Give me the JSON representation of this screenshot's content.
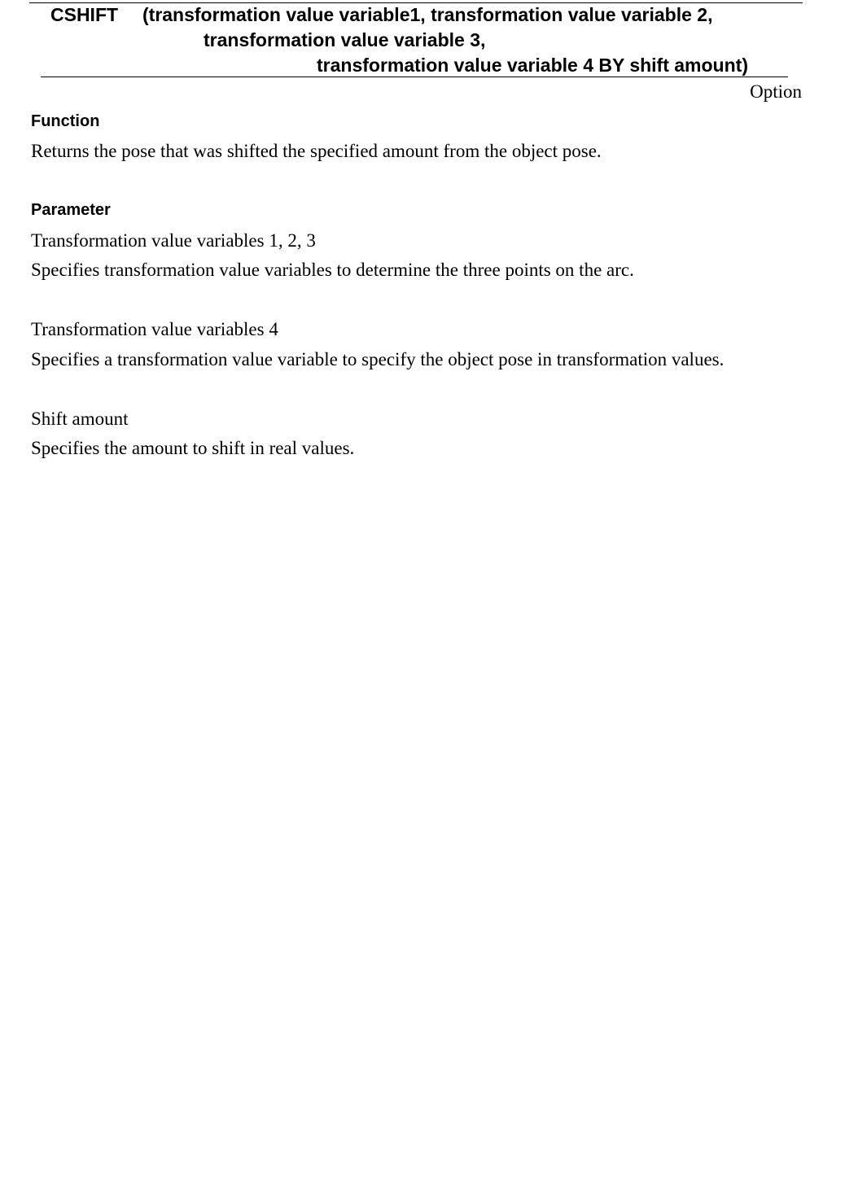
{
  "signature": {
    "name": "CSHIFT",
    "line1": "(transformation value variable1, transformation value variable 2,",
    "line2": "transformation value variable 3,",
    "line3": "transformation value variable 4 BY shift amount)"
  },
  "option_label": "Option",
  "function": {
    "heading": "Function",
    "text": "Returns the pose that was shifted the specified amount from the object pose."
  },
  "parameter": {
    "heading": "Parameter",
    "items": [
      {
        "name": "Transformation value variables 1, 2, 3",
        "description": "Specifies transformation value variables to determine the three points on the arc."
      },
      {
        "name": "Transformation value variables 4",
        "description": "Specifies a transformation value variable to specify the object pose in transformation values."
      },
      {
        "name": "Shift amount",
        "description": "Specifies the amount to shift in real values."
      }
    ]
  }
}
